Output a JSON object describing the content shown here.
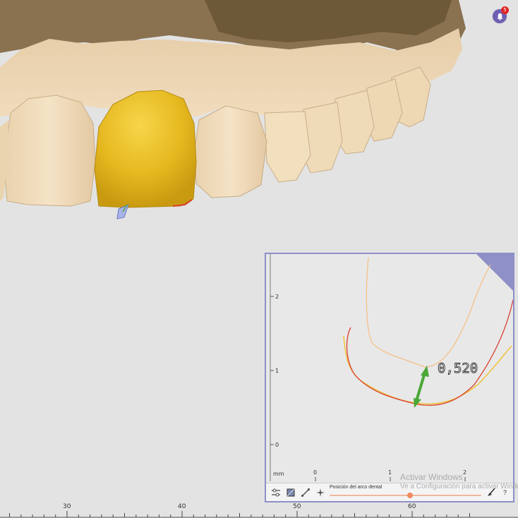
{
  "notifications": {
    "count": "5",
    "icon": "bell-icon"
  },
  "section_view": {
    "unit_label": "mm",
    "y_ticks": [
      "2",
      "1",
      "0"
    ],
    "x_ticks": [
      "0",
      "1",
      "2"
    ],
    "measurement_label": "0,520",
    "colors": {
      "tooth_outline": "#e6a740",
      "crown_outer": "#f0c13a",
      "antagonist": "#d84030",
      "light_outline": "#f6c08a",
      "arrow": "#4aa838",
      "panel_border": "#8f8fc8"
    }
  },
  "toolbar": {
    "buttons": [
      {
        "name": "sliders-icon"
      },
      {
        "name": "cube-view-icon"
      },
      {
        "name": "measure-tool-icon"
      },
      {
        "name": "crosshair-icon"
      }
    ],
    "slider": {
      "label": "Posición del arco dental",
      "value_fraction": 0.53
    },
    "right_buttons": [
      {
        "name": "brush-icon"
      },
      {
        "label": "?"
      }
    ]
  },
  "watermark": {
    "line1": "Activar Windows",
    "line2": "Ve a Configuración para activar Windows."
  },
  "ruler": {
    "labels": [
      "30",
      "40",
      "50",
      "60"
    ]
  },
  "chart_data": {
    "type": "line",
    "title": "",
    "xlabel": "mm",
    "ylabel": "",
    "x_ticks": [
      0,
      1,
      2
    ],
    "y_ticks": [
      0,
      1,
      2
    ],
    "annotation": {
      "text": "0,520",
      "from": [
        1.4,
        0.5
      ],
      "to": [
        1.5,
        1.0
      ]
    }
  }
}
